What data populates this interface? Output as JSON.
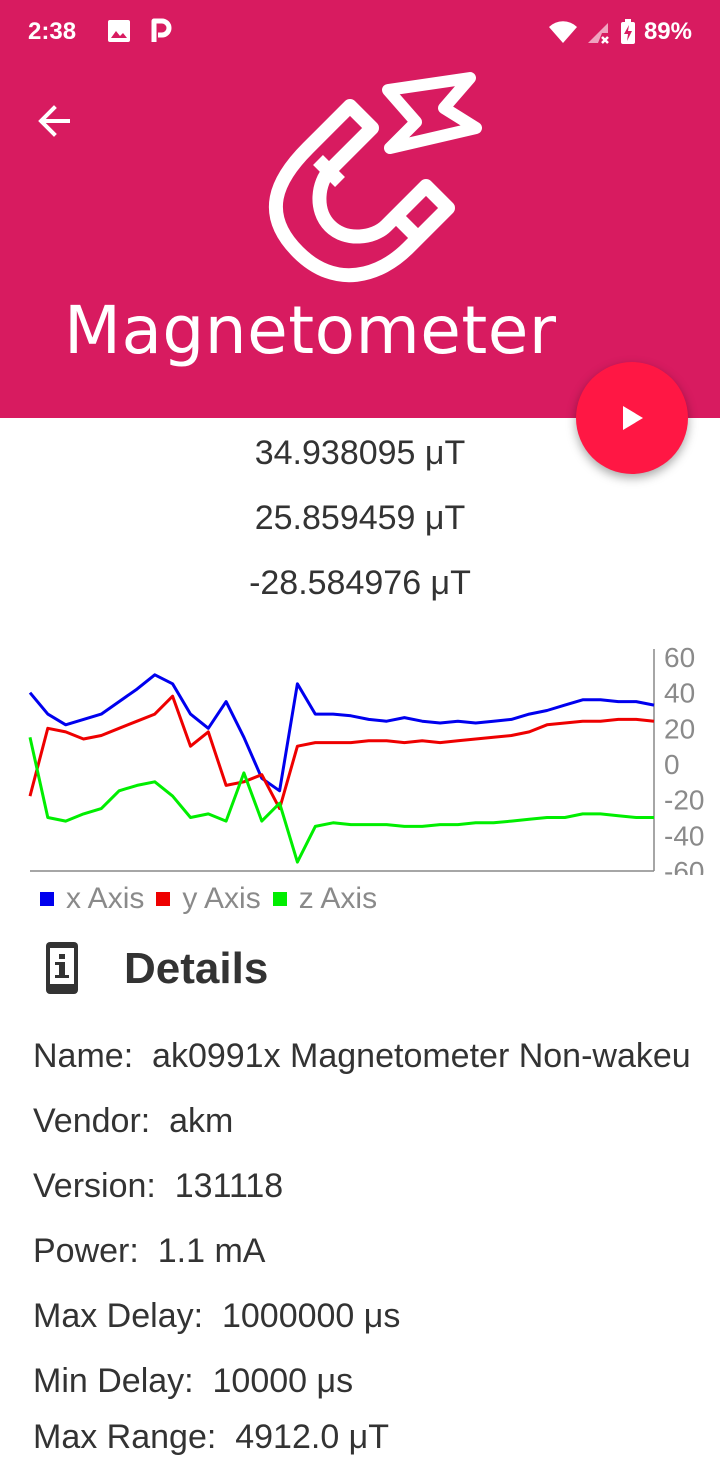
{
  "status_bar": {
    "time": "2:38",
    "battery": "89%",
    "icons": [
      "image-icon",
      "p-icon",
      "wifi-icon",
      "signal-icon",
      "battery-icon"
    ]
  },
  "header": {
    "title": "Magnetometer",
    "background": "#d81b60",
    "icon": "magnet-icon"
  },
  "fab": {
    "icon": "play-icon",
    "color": "#ff1744"
  },
  "readings": {
    "x": "34.938095 μT",
    "y": "25.859459 μT",
    "z": "-28.584976 μT"
  },
  "chart_data": {
    "type": "line",
    "ylim": [
      -60,
      60
    ],
    "y_ticks": [
      "60",
      "40",
      "20",
      "0",
      "-20",
      "-40",
      "-60"
    ],
    "legend_placement": "bottom-left",
    "grid": false,
    "series": [
      {
        "name": "x Axis",
        "color": "#0000ee",
        "values": [
          40,
          28,
          22,
          25,
          28,
          35,
          42,
          50,
          45,
          28,
          20,
          35,
          15,
          -8,
          -15,
          45,
          28,
          28,
          27,
          25,
          24,
          26,
          24,
          23,
          24,
          23,
          24,
          25,
          28,
          30,
          33,
          36,
          36,
          35,
          35,
          33
        ]
      },
      {
        "name": "y Axis",
        "color": "#ee0000",
        "values": [
          -18,
          20,
          18,
          14,
          16,
          20,
          24,
          28,
          38,
          10,
          18,
          -12,
          -10,
          -6,
          -25,
          10,
          12,
          12,
          12,
          13,
          13,
          12,
          13,
          12,
          13,
          14,
          15,
          16,
          18,
          22,
          23,
          24,
          24,
          25,
          25,
          24
        ]
      },
      {
        "name": "z Axis",
        "color": "#00ee00",
        "values": [
          15,
          -30,
          -32,
          -28,
          -25,
          -15,
          -12,
          -10,
          -18,
          -30,
          -28,
          -32,
          -5,
          -32,
          -22,
          -55,
          -35,
          -33,
          -34,
          -34,
          -34,
          -35,
          -35,
          -34,
          -34,
          -33,
          -33,
          -32,
          -31,
          -30,
          -30,
          -28,
          -28,
          -29,
          -30,
          -30
        ]
      }
    ]
  },
  "details": {
    "title": "Details",
    "icon": "info-icon",
    "rows": [
      {
        "label": "Name:",
        "value": "ak0991x Magnetometer Non-wakeu"
      },
      {
        "label": "Vendor:",
        "value": "akm"
      },
      {
        "label": "Version:",
        "value": "131118"
      },
      {
        "label": "Power:",
        "value": "1.1 mA"
      },
      {
        "label": "Max Delay:",
        "value": "1000000 μs"
      },
      {
        "label": "Min Delay:",
        "value": "10000 μs"
      },
      {
        "label": "Max Range:",
        "value": "4912.0 μT"
      }
    ]
  }
}
